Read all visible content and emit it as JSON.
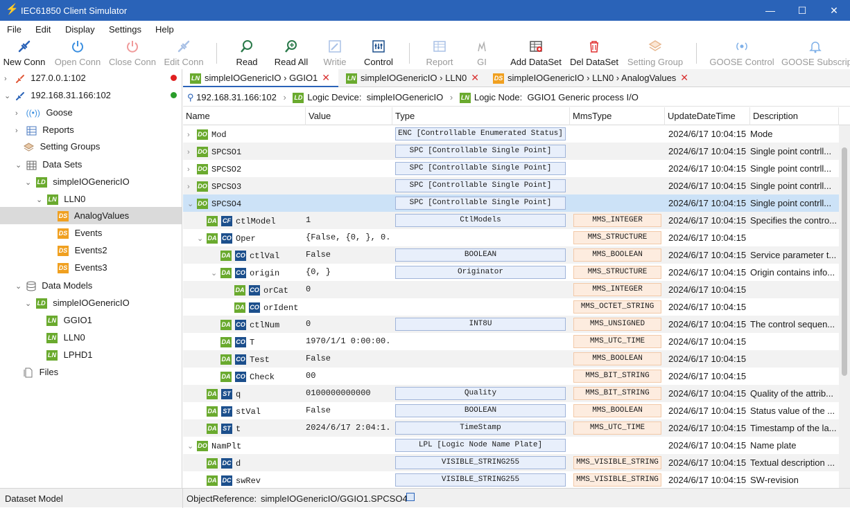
{
  "app": {
    "title": "IEC61850 Client Simulator"
  },
  "menu": [
    "File",
    "Edit",
    "Display",
    "Settings",
    "Help"
  ],
  "toolbar": {
    "new_conn": "New Conn",
    "open_conn": "Open Conn",
    "close_conn": "Close Conn",
    "edit_conn": "Edit Conn",
    "read": "Read",
    "read_all": "Read All",
    "write": "Writie",
    "control": "Control",
    "report": "Report",
    "gi": "GI",
    "add_dataset": "Add DataSet",
    "del_dataset": "Del DataSet",
    "setting_group": "Setting Group",
    "goose_control": "GOOSE Control",
    "goose_subscript": "GOOSE Subscript"
  },
  "tree": {
    "server1": "127.0.0.1:102",
    "server2": "192.168.31.166:102",
    "goose": "Goose",
    "reports": "Reports",
    "setting_groups": "Setting Groups",
    "data_sets": "Data Sets",
    "ds_ld": "simpleIOGenericIO",
    "ds_ln": "LLN0",
    "ds_items": [
      "AnalogValues",
      "Events",
      "Events2",
      "Events3"
    ],
    "data_models": "Data Models",
    "dm_ld": "simpleIOGenericIO",
    "dm_lns": [
      "GGIO1",
      "LLN0",
      "LPHD1"
    ],
    "files": "Files",
    "badges": {
      "ld": "LD",
      "ln": "LN",
      "ds": "DS"
    }
  },
  "tabs": [
    {
      "badge": "LN",
      "path": "simpleIOGenericIO",
      "node": "GGIO1"
    },
    {
      "badge": "LN",
      "path": "simpleIOGenericIO",
      "node": "LLN0"
    },
    {
      "badge": "DS",
      "path": "simpleIOGenericIO",
      "node": "LLN0",
      "leaf": "AnalogValues"
    }
  ],
  "breadcrumb": {
    "server": "192.168.31.166:102",
    "ld_label": "Logic Device:",
    "ld_value": "simpleIOGenericIO",
    "ln_label": "Logic Node:",
    "ln_value": "GGIO1  Generic process I/O"
  },
  "columns": {
    "name": "Name",
    "value": "Value",
    "type": "Type",
    "mms": "MmsType",
    "time": "UpdateDateTime",
    "desc": "Description"
  },
  "rows": [
    {
      "b1": "DO",
      "b2": "",
      "name": "Mod",
      "value": "",
      "type": "ENC [Controllable Enumerated Status]",
      "mms": "",
      "time": "2024/6/17 10:04:15",
      "desc": "Mode"
    },
    {
      "b1": "DO",
      "b2": "",
      "name": "SPCSO1",
      "value": "",
      "type": "SPC [Controllable Single Point]",
      "mms": "",
      "time": "2024/6/17 10:04:15",
      "desc": "Single point contrll..."
    },
    {
      "b1": "DO",
      "b2": "",
      "name": "SPCSO2",
      "value": "",
      "type": "SPC [Controllable Single Point]",
      "mms": "",
      "time": "2024/6/17 10:04:15",
      "desc": "Single point contrll..."
    },
    {
      "b1": "DO",
      "b2": "",
      "name": "SPCSO3",
      "value": "",
      "type": "SPC [Controllable Single Point]",
      "mms": "",
      "time": "2024/6/17 10:04:15",
      "desc": "Single point contrll..."
    },
    {
      "b1": "DO",
      "b2": "",
      "name": "SPCSO4",
      "value": "",
      "type": "SPC [Controllable Single Point]",
      "mms": "",
      "time": "2024/6/17 10:04:15",
      "desc": "Single point contrll..."
    },
    {
      "b1": "DA",
      "b2": "CF",
      "name": "ctlModel",
      "value": "1",
      "type": "CtlModels",
      "mms": "MMS_INTEGER",
      "time": "2024/6/17 10:04:15",
      "desc": "Specifies the contro..."
    },
    {
      "b1": "DA",
      "b2": "CO",
      "name": "Oper",
      "value": "{False, {0, }, 0...",
      "type": "",
      "mms": "MMS_STRUCTURE",
      "time": "2024/6/17 10:04:15",
      "desc": ""
    },
    {
      "b1": "DA",
      "b2": "CO",
      "name": "ctlVal",
      "value": "False",
      "type": "BOOLEAN",
      "mms": "MMS_BOOLEAN",
      "time": "2024/6/17 10:04:15",
      "desc": "Service parameter t..."
    },
    {
      "b1": "DA",
      "b2": "CO",
      "name": "origin",
      "value": "{0, }",
      "type": "Originator",
      "mms": "MMS_STRUCTURE",
      "time": "2024/6/17 10:04:15",
      "desc": "Origin contains info..."
    },
    {
      "b1": "DA",
      "b2": "CO",
      "name": "orCat",
      "value": "0",
      "type": "",
      "mms": "MMS_INTEGER",
      "time": "2024/6/17 10:04:15",
      "desc": ""
    },
    {
      "b1": "DA",
      "b2": "CO",
      "name": "orIdent",
      "value": "",
      "type": "",
      "mms": "MMS_OCTET_STRING",
      "time": "2024/6/17 10:04:15",
      "desc": ""
    },
    {
      "b1": "DA",
      "b2": "CO",
      "name": "ctlNum",
      "value": "0",
      "type": "INT8U",
      "mms": "MMS_UNSIGNED",
      "time": "2024/6/17 10:04:15",
      "desc": "The control sequen..."
    },
    {
      "b1": "DA",
      "b2": "CO",
      "name": "T",
      "value": "1970/1/1 0:00:00...",
      "type": "",
      "mms": "MMS_UTC_TIME",
      "time": "2024/6/17 10:04:15",
      "desc": ""
    },
    {
      "b1": "DA",
      "b2": "CO",
      "name": "Test",
      "value": "False",
      "type": "",
      "mms": "MMS_BOOLEAN",
      "time": "2024/6/17 10:04:15",
      "desc": ""
    },
    {
      "b1": "DA",
      "b2": "CO",
      "name": "Check",
      "value": "00",
      "type": "",
      "mms": "MMS_BIT_STRING",
      "time": "2024/6/17 10:04:15",
      "desc": ""
    },
    {
      "b1": "DA",
      "b2": "ST",
      "name": "q",
      "value": "0100000000000",
      "type": "Quality",
      "mms": "MMS_BIT_STRING",
      "time": "2024/6/17 10:04:15",
      "desc": "Quality of the attrib..."
    },
    {
      "b1": "DA",
      "b2": "ST",
      "name": "stVal",
      "value": "False",
      "type": "BOOLEAN",
      "mms": "MMS_BOOLEAN",
      "time": "2024/6/17 10:04:15",
      "desc": "Status value of the ..."
    },
    {
      "b1": "DA",
      "b2": "ST",
      "name": "t",
      "value": "2024/6/17 2:04:1...",
      "type": "TimeStamp",
      "mms": "MMS_UTC_TIME",
      "time": "2024/6/17 10:04:15",
      "desc": "Timestamp of the la..."
    },
    {
      "b1": "DO",
      "b2": "",
      "name": "NamPlt",
      "value": "",
      "type": "LPL [Logic Node Name Plate]",
      "mms": "",
      "time": "2024/6/17 10:04:15",
      "desc": "Name plate"
    },
    {
      "b1": "DA",
      "b2": "DC",
      "name": "d",
      "value": "",
      "type": "VISIBLE_STRING255",
      "mms": "MMS_VISIBLE_STRING",
      "time": "2024/6/17 10:04:15",
      "desc": "Textual description ..."
    },
    {
      "b1": "DA",
      "b2": "DC",
      "name": "swRev",
      "value": "",
      "type": "VISIBLE_STRING255",
      "mms": "MMS_VISIBLE_STRING",
      "time": "2024/6/17 10:04:15",
      "desc": "SW-revision"
    }
  ],
  "status": {
    "left": "Dataset Model",
    "ref_label": "ObjectReference:",
    "ref_value": "simpleIOGenericIO/GGIO1.SPCSO4"
  },
  "colors": {
    "accent": "#2a63b8",
    "selected_row": "#cce2f7",
    "connected": "#2a9d2a",
    "disconnected": "#e02020"
  }
}
